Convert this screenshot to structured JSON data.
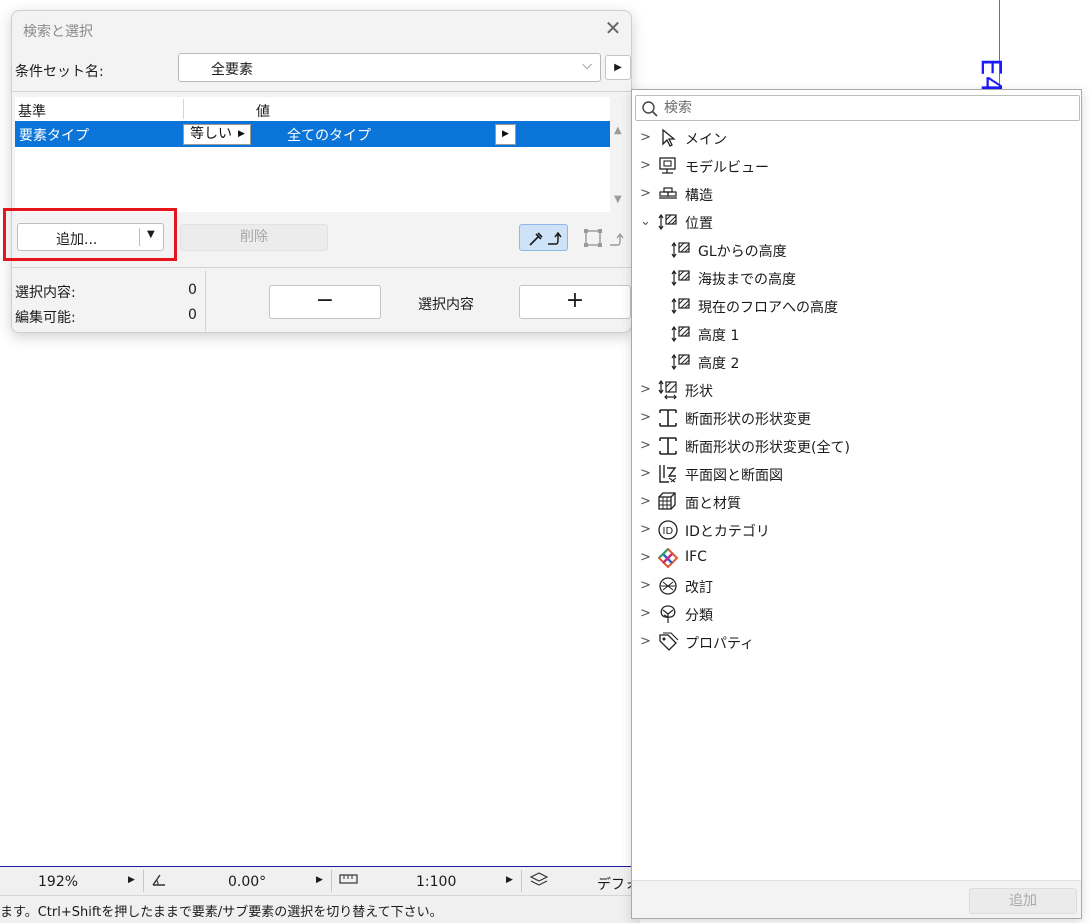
{
  "canvas": {
    "marker_text": "E4"
  },
  "dialog": {
    "title": "検索と選択",
    "close_glyph": "✕",
    "criteria_set_label": "条件セット名:",
    "criteria_set_value": "全要素",
    "table": {
      "col_criterion": "基準",
      "col_value": "値",
      "rows": [
        {
          "criterion": "要素タイプ",
          "operator": "等しい",
          "value": "全てのタイプ"
        }
      ]
    },
    "add_button": "追加...",
    "delete_button": "削除",
    "selected_label": "選択内容:",
    "selected_count": "0",
    "editable_label": "編集可能:",
    "editable_count": "0",
    "minus_button": "−",
    "plus_button": "+",
    "selection_content_label": "選択内容"
  },
  "statusbar": {
    "zoom": "192%",
    "angle": "0.00°",
    "scale": "1:100",
    "layer": "デフォ",
    "message": "ます。Ctrl+Shiftを押したままで要素/サブ要素の選択を切り替えて下さい。"
  },
  "popup": {
    "search_placeholder": "検索",
    "items": [
      {
        "label": "メイン",
        "icon": "cursor-icon"
      },
      {
        "label": "モデルビュー",
        "icon": "model-view-icon"
      },
      {
        "label": "構造",
        "icon": "structure-icon"
      },
      {
        "label": "位置",
        "icon": "position-icon",
        "expanded": true,
        "children": [
          {
            "label": "GLからの高度"
          },
          {
            "label": "海抜までの高度"
          },
          {
            "label": "現在のフロアへの高度"
          },
          {
            "label": "高度 1"
          },
          {
            "label": "高度 2"
          }
        ]
      },
      {
        "label": "形状",
        "icon": "shape-icon"
      },
      {
        "label": "断面形状の形状変更",
        "icon": "profile-icon"
      },
      {
        "label": "断面形状の形状変更(全て)",
        "icon": "profile-icon"
      },
      {
        "label": "平面図と断面図",
        "icon": "plan-section-icon"
      },
      {
        "label": "面と材質",
        "icon": "surface-material-icon"
      },
      {
        "label": "IDとカテゴリ",
        "icon": "id-icon"
      },
      {
        "label": "IFC",
        "icon": "ifc-icon"
      },
      {
        "label": "改訂",
        "icon": "revision-icon"
      },
      {
        "label": "分類",
        "icon": "classification-icon"
      },
      {
        "label": "プロパティ",
        "icon": "property-icon"
      }
    ],
    "add_button": "追加"
  }
}
